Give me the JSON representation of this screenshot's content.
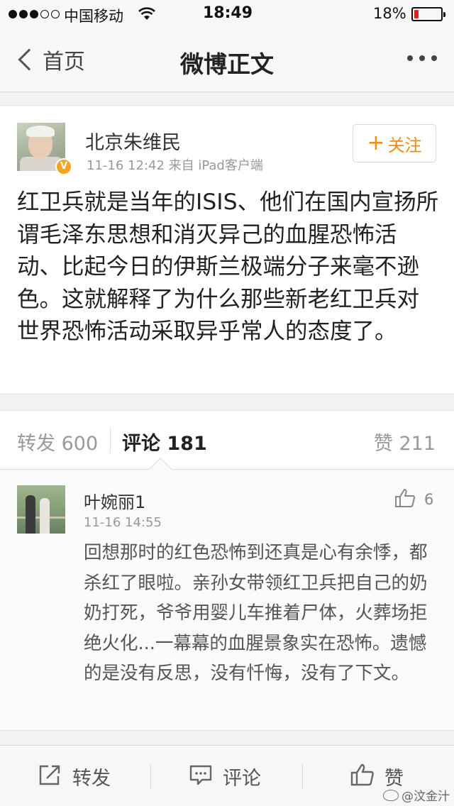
{
  "status_bar": {
    "carrier": "中国移动",
    "time": "18:49",
    "battery_percent": "18%",
    "battery_level": 0.18,
    "battery_color": "#e0201c",
    "signal_filled": 3,
    "signal_total": 5
  },
  "nav": {
    "back_label": "首页",
    "title": "微博正文",
    "more_icon": "more-horizontal-icon"
  },
  "post": {
    "author": "北京朱维民",
    "verified_badge": "V",
    "meta": "11-16 12:42   来自 iPad客户端",
    "follow_label": "关注",
    "text": "红卫兵就是当年的ISIS、他们在国内宣扬所谓毛泽东思想和消灭异己的血腥恐怖活动、比起今日的伊斯兰极端分子来毫不逊色。这就解释了为什么那些新老红卫兵对世界恐怖活动采取异乎常人的态度了。"
  },
  "stats": {
    "repost": "转发 600",
    "comment": "评论 181",
    "like": "赞 211"
  },
  "comments": [
    {
      "author": "叶婉丽1",
      "time": "11-16 14:55",
      "like_count": "6",
      "text": "回想那时的红色恐怖到还真是心有余悸，都杀红了眼啦。亲孙女带领红卫兵把自己的奶奶打死，爷爷用婴儿车推着尸体，火葬场拒绝火化...一幕幕的血腥景象实在恐怖。遗憾的是没有反思，没有忏悔，没有了下文。"
    }
  ],
  "toolbar": {
    "repost_label": "转发",
    "comment_label": "评论",
    "like_label": "赞"
  },
  "watermark": "@汶金汁",
  "colors": {
    "accent_orange": "#f18b12",
    "verified_badge": "#f4a521"
  }
}
